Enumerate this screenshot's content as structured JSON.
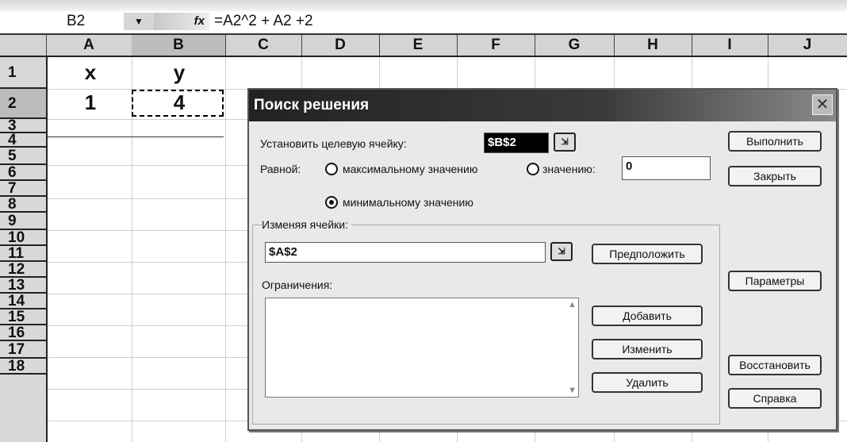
{
  "formula_bar": {
    "name_box": "B2",
    "fx_label": "fx",
    "formula": "=A2^2 + A2 +2"
  },
  "columns": [
    "A",
    "B",
    "C",
    "D",
    "E",
    "F",
    "G",
    "H",
    "I",
    "J"
  ],
  "rows": [
    "1",
    "2",
    "3",
    "4",
    "5",
    "6",
    "7",
    "8",
    "9",
    "10",
    "11",
    "12",
    "13",
    "14",
    "15",
    "16",
    "17",
    "18"
  ],
  "cells": {
    "A1": "x",
    "B1": "y",
    "A2": "1",
    "B2": "4"
  },
  "dialog": {
    "title": "Поиск решения",
    "close_icon": "close-icon",
    "target_label": "Установить целевую ячейку:",
    "target_value": "$B$2",
    "equal_label": "Равной:",
    "radio_max": "максимальному значению",
    "radio_value": "значению:",
    "value_input": "0",
    "radio_min": "минимальному значению",
    "radio_selected": "min",
    "changing_label": "Изменяя ячейки:",
    "changing_value": "$A$2",
    "guess_button": "Предположить",
    "constraints_label": "Ограничения:",
    "add_button": "Добавить",
    "change_button": "Изменить",
    "delete_button": "Удалить",
    "run_button": "Выполнить",
    "close_button": "Закрыть",
    "options_button": "Параметры",
    "reset_button": "Восстановить",
    "help_button": "Справка"
  }
}
